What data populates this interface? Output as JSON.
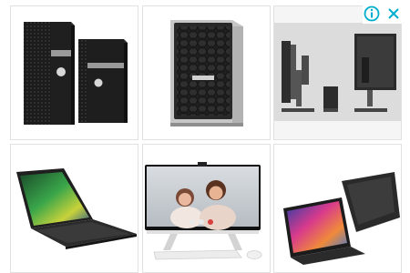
{
  "ad": {
    "adchoices_icon": "info-circle-icon",
    "close_icon": "close-x-icon",
    "accent_color": "#00aecd"
  },
  "products": [
    {
      "slot": 1,
      "depicts": "mini-tower-desktops"
    },
    {
      "slot": 2,
      "depicts": "tower-server"
    },
    {
      "slot": 3,
      "depicts": "micro-pc-with-monitor-stand"
    },
    {
      "slot": 4,
      "depicts": "laptop"
    },
    {
      "slot": 5,
      "depicts": "all-in-one-desktop"
    },
    {
      "slot": 6,
      "depicts": "2-in-1-laptops"
    }
  ]
}
